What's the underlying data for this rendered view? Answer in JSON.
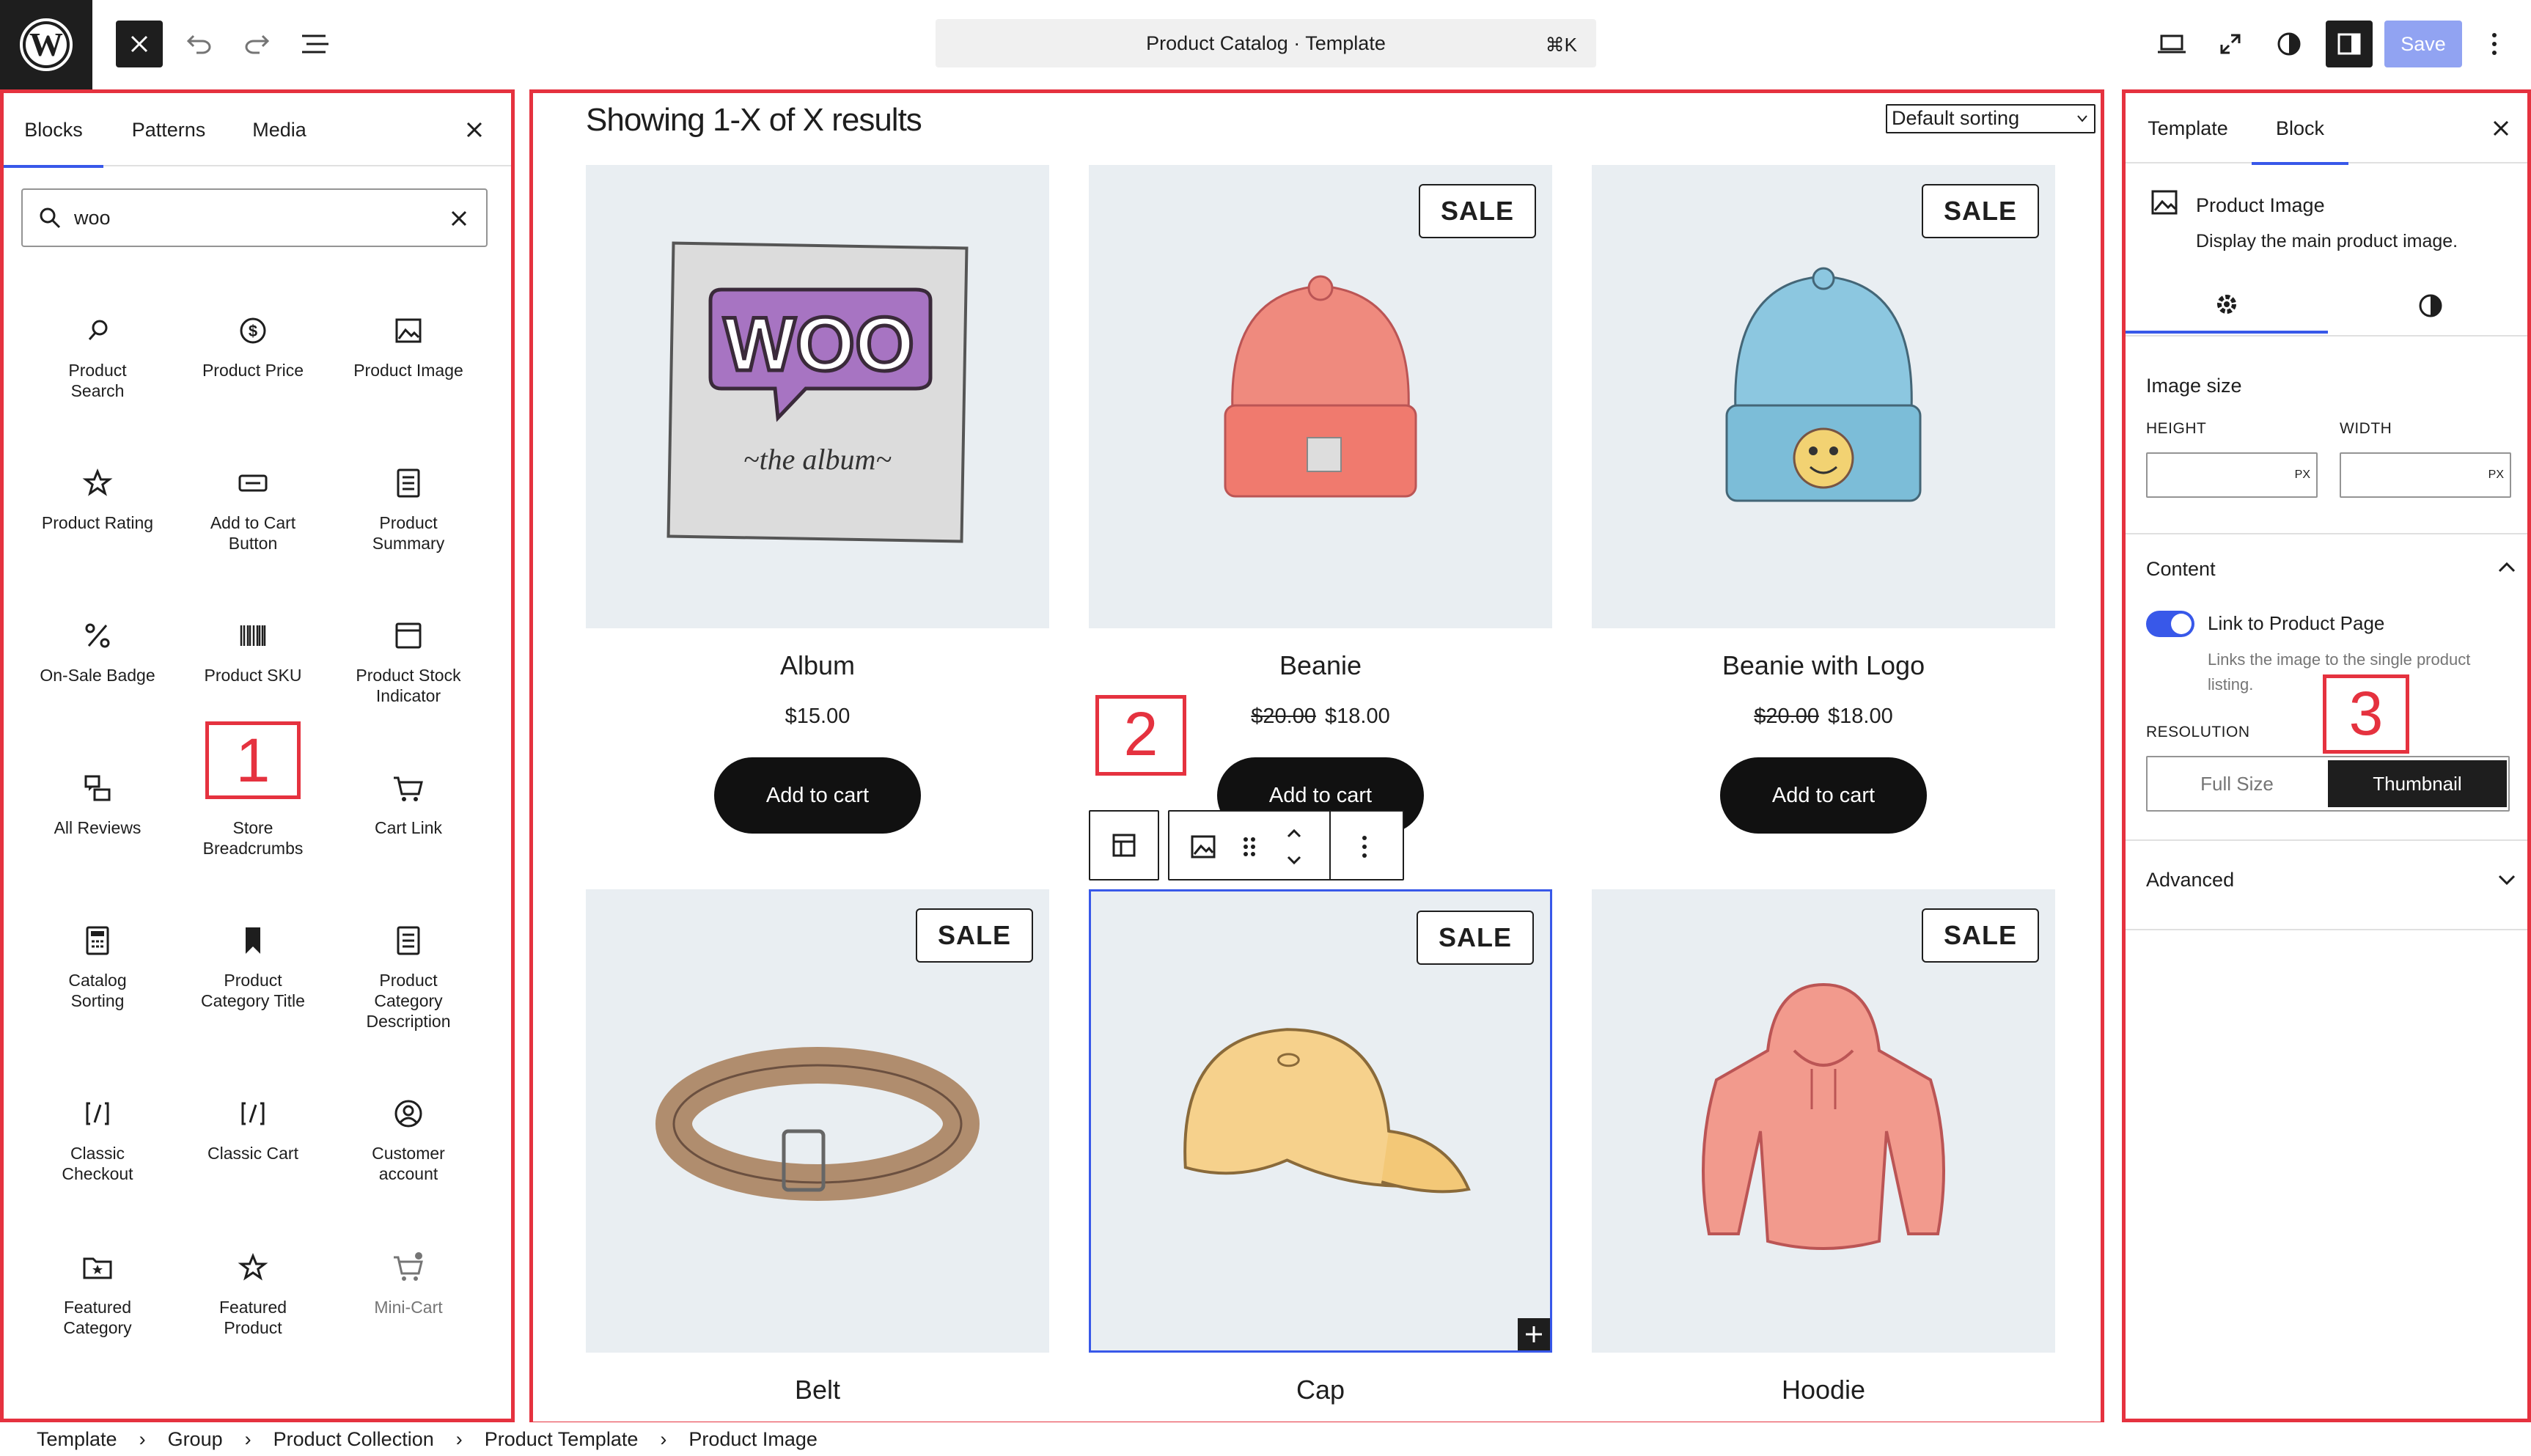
{
  "header": {
    "document_title": "Product Catalog · Template",
    "shortcut": "⌘K",
    "save_label": "Save"
  },
  "inserter": {
    "tabs": [
      "Blocks",
      "Patterns",
      "Media"
    ],
    "search_value": "woo",
    "blocks": [
      {
        "label": "Product\nSearch",
        "icon": "search-icon"
      },
      {
        "label": "Product Price",
        "icon": "dollar-icon"
      },
      {
        "label": "Product Image",
        "icon": "image-icon"
      },
      {
        "label": "Product Rating",
        "icon": "star-icon"
      },
      {
        "label": "Add to Cart\nButton",
        "icon": "button-icon"
      },
      {
        "label": "Product\nSummary",
        "icon": "document-icon"
      },
      {
        "label": "On-Sale Badge",
        "icon": "percent-icon"
      },
      {
        "label": "Product SKU",
        "icon": "barcode-icon"
      },
      {
        "label": "Product Stock\nIndicator",
        "icon": "box-icon"
      },
      {
        "label": "All Reviews",
        "icon": "reviews-icon"
      },
      {
        "label": "Store\nBreadcrumbs",
        "icon": "more-dots-icon"
      },
      {
        "label": "Cart Link",
        "icon": "cart-icon"
      },
      {
        "label": "Catalog\nSorting",
        "icon": "calculator-icon"
      },
      {
        "label": "Product\nCategory Title",
        "icon": "bookmark-icon"
      },
      {
        "label": "Product\nCategory\nDescription",
        "icon": "document-icon"
      },
      {
        "label": "Classic\nCheckout",
        "icon": "shortcode-icon"
      },
      {
        "label": "Classic Cart",
        "icon": "shortcode-icon"
      },
      {
        "label": "Customer\naccount",
        "icon": "user-circle-icon"
      },
      {
        "label": "Featured\nCategory",
        "icon": "folder-star-icon"
      },
      {
        "label": "Featured\nProduct",
        "icon": "star-icon"
      },
      {
        "label": "Mini-Cart",
        "icon": "mini-cart-icon"
      }
    ]
  },
  "canvas": {
    "results_text": "Showing 1-X of X results",
    "sorting": "Default sorting",
    "sale_label": "SALE",
    "add_to_cart": "Add to cart",
    "products": [
      {
        "name": "Album",
        "price": "$15.00",
        "old_price": "",
        "sale": false
      },
      {
        "name": "Beanie",
        "price": "$18.00",
        "old_price": "$20.00",
        "sale": true
      },
      {
        "name": "Beanie with Logo",
        "price": "$18.00",
        "old_price": "$20.00",
        "sale": true
      },
      {
        "name": "Belt",
        "sale": true
      },
      {
        "name": "Cap",
        "sale": true
      },
      {
        "name": "Hoodie",
        "sale": true
      }
    ]
  },
  "settings": {
    "tabs": [
      "Template",
      "Block"
    ],
    "block_title": "Product Image",
    "block_desc": "Display the main product image.",
    "image_size_title": "Image size",
    "height_label": "HEIGHT",
    "width_label": "WIDTH",
    "unit": "PX",
    "content_title": "Content",
    "toggle_label": "Link to Product Page",
    "toggle_help": "Links the image to the single product listing.",
    "resolution_label": "RESOLUTION",
    "res_options": [
      "Full Size",
      "Thumbnail"
    ],
    "advanced_title": "Advanced"
  },
  "breadcrumb": [
    "Template",
    "Group",
    "Product Collection",
    "Product Template",
    "Product Image"
  ],
  "annotations": [
    "1",
    "2",
    "3"
  ],
  "colors": {
    "accent": "#3858e9",
    "annotation": "#e5323f"
  }
}
